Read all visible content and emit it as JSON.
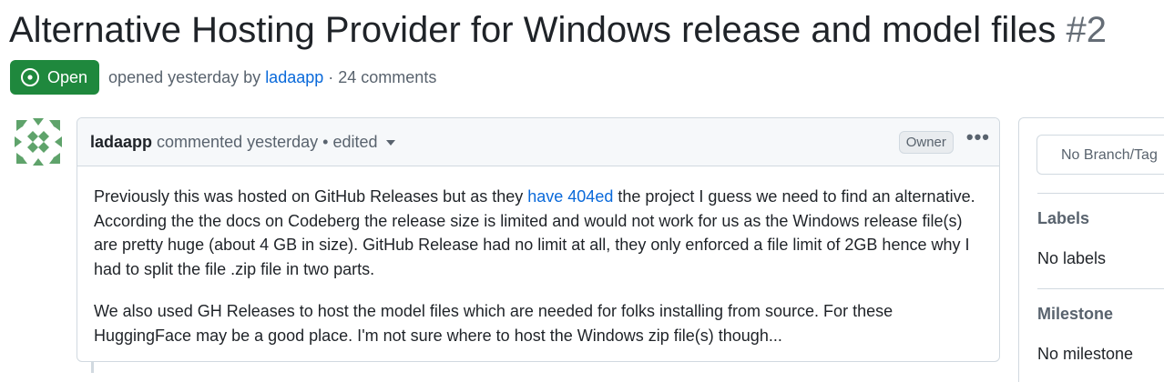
{
  "issue": {
    "title": "Alternative Hosting Provider for Windows release and model files",
    "number": "#2",
    "state": "Open",
    "state_icon": "issue-opened-icon",
    "meta_prefix": "opened yesterday by",
    "author": "ladaapp",
    "meta_suffix": "· 24 comments"
  },
  "comment": {
    "author": "ladaapp",
    "action": "commented yesterday",
    "edited": "• edited",
    "badge": "Owner",
    "menu_glyph": "•••",
    "p1_before": "Previously this was hosted on GitHub Releases but as they ",
    "p1_link": "have 404ed",
    "p1_after": " the project I guess we need to find an alternative. According the the docs on Codeberg the release size is limited and would not work for us as the Windows release file(s) are pretty huge (about 4 GB in size). GitHub Release had no limit at all, they only enforced a file limit of 2GB hence why I had to split the file .zip file in two parts.",
    "p2": "We also used GH Releases to host the model files which are needed for folks installing from source. For these HuggingFace may be a good place. I'm not sure where to host the Windows zip file(s) though..."
  },
  "sidebar": {
    "branch_placeholder": "No Branch/Tag",
    "labels_heading": "Labels",
    "labels_value": "No labels",
    "milestone_heading": "Milestone",
    "milestone_value": "No milestone"
  },
  "colors": {
    "open_green": "#1f883d",
    "link_blue": "#0969da",
    "avatar_green": "#5fa36b"
  }
}
